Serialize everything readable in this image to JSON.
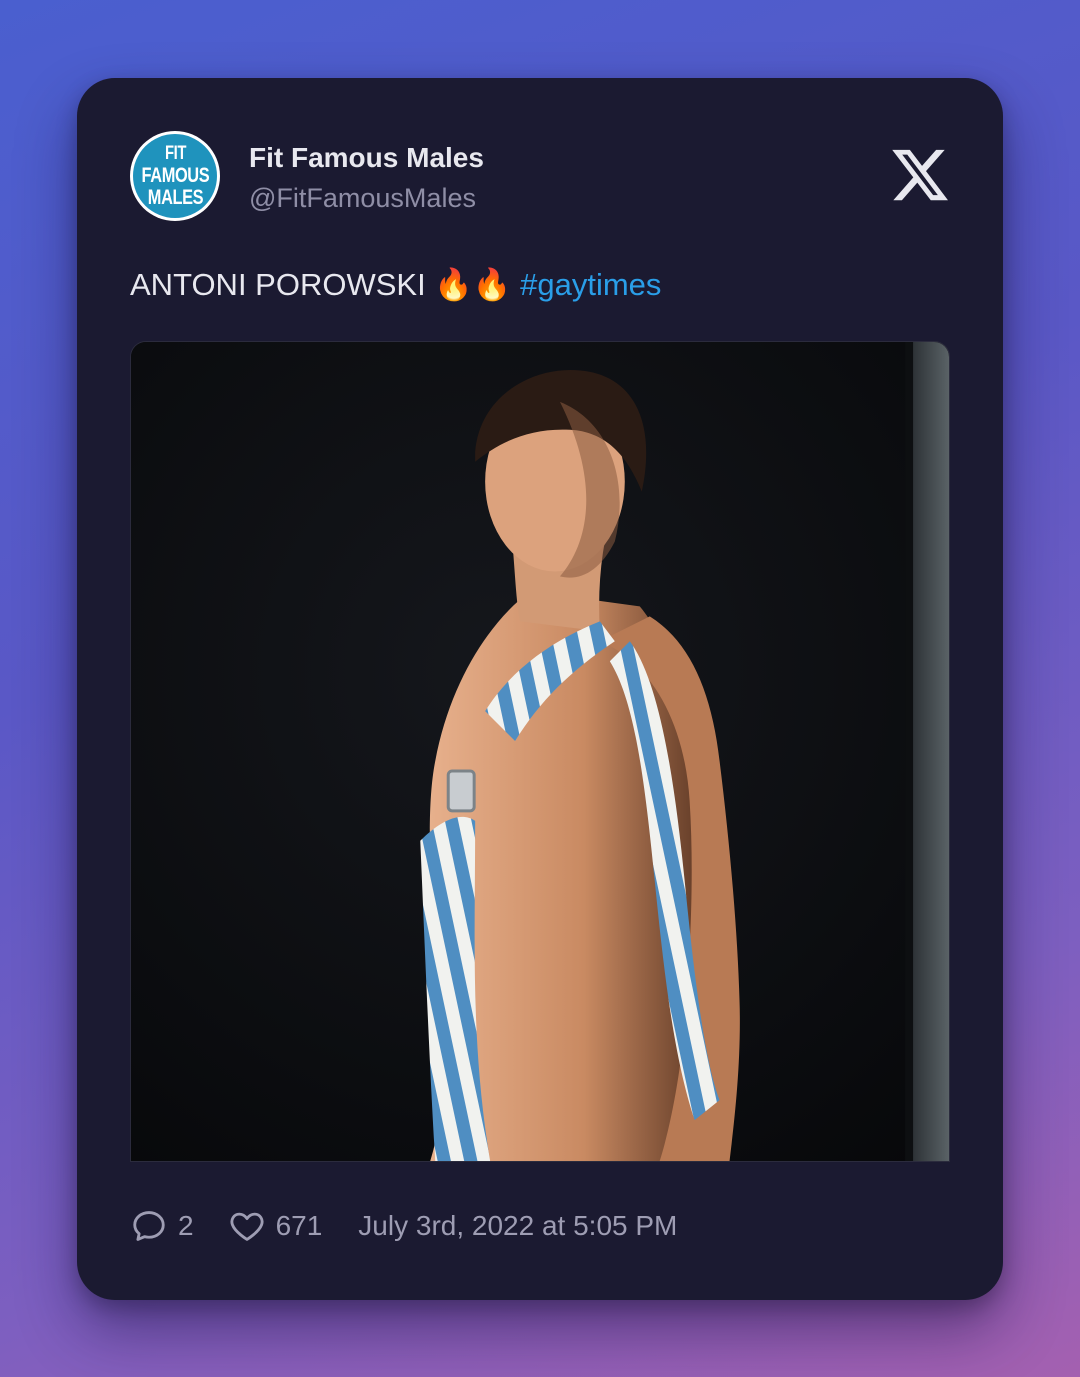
{
  "tweet": {
    "avatar": {
      "lines": [
        "FIT",
        "FAMOUS",
        "MALES"
      ],
      "color": "#1f93bd"
    },
    "display_name": "Fit Famous Males",
    "handle": "@FitFamousMales",
    "platform_icon": "x-logo-icon",
    "text": "ANTONI POROWSKI 🔥🔥",
    "hashtag": "#gaytimes",
    "media_alt": "Photo of a shirtless man in blue and white striped overalls against a dark background",
    "replies": "2",
    "likes": "671",
    "timestamp": "July 3rd, 2022 at 5:05 PM"
  },
  "colors": {
    "card_background": "#1b1a31",
    "hashtag": "#2a9ee8",
    "secondary_text": "#8f8ea6"
  }
}
